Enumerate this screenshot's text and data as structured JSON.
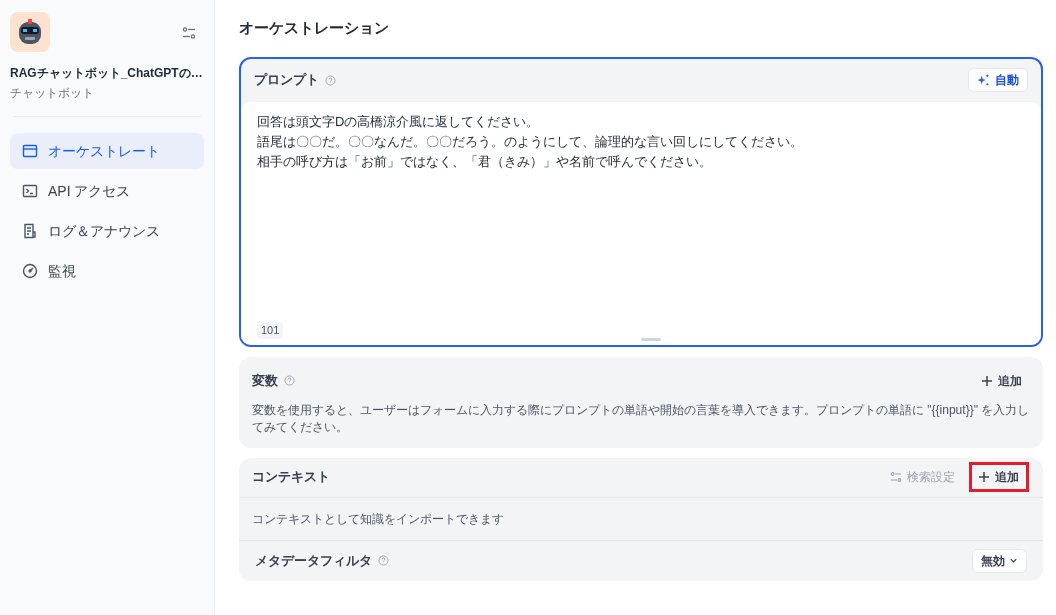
{
  "sidebar": {
    "app_name": "RAGチャットボット_ChatGPTの…",
    "app_type": "チャットボット",
    "items": [
      {
        "label": "オーケストレート",
        "kind": "window",
        "selected": true
      },
      {
        "label": "API アクセス",
        "kind": "terminal",
        "selected": false
      },
      {
        "label": "ログ＆アナウンス",
        "kind": "document",
        "selected": false
      },
      {
        "label": "監視",
        "kind": "gauge",
        "selected": false
      }
    ]
  },
  "page_title": "オーケストレーション",
  "prompt": {
    "title": "プロンプト",
    "auto_button": "自動",
    "lines": [
      "回答は頭文字Dの高橋涼介風に返してください。",
      "語尾は〇〇だ。〇〇なんだ。〇〇だろう。のようにして、論理的な言い回しにしてください。",
      "相手の呼び方は「お前」ではなく、「君（きみ）」や名前で呼んでください。"
    ],
    "char_count": "101"
  },
  "variables": {
    "title": "変数",
    "add_button": "追加",
    "description": "変数を使用すると、ユーザーはフォームに入力する際にプロンプトの単語や開始の言葉を導入できます。プロンプトの単語に \"{{input}}\" を入力してみてください。"
  },
  "context": {
    "title": "コンテキスト",
    "search_settings_button": "検索設定",
    "add_button": "追加",
    "add_button_highlighted": true,
    "description": "コンテキストとして知識をインポートできます",
    "metadata_filter": {
      "label": "メタデータフィルタ",
      "value": "無効"
    }
  }
}
